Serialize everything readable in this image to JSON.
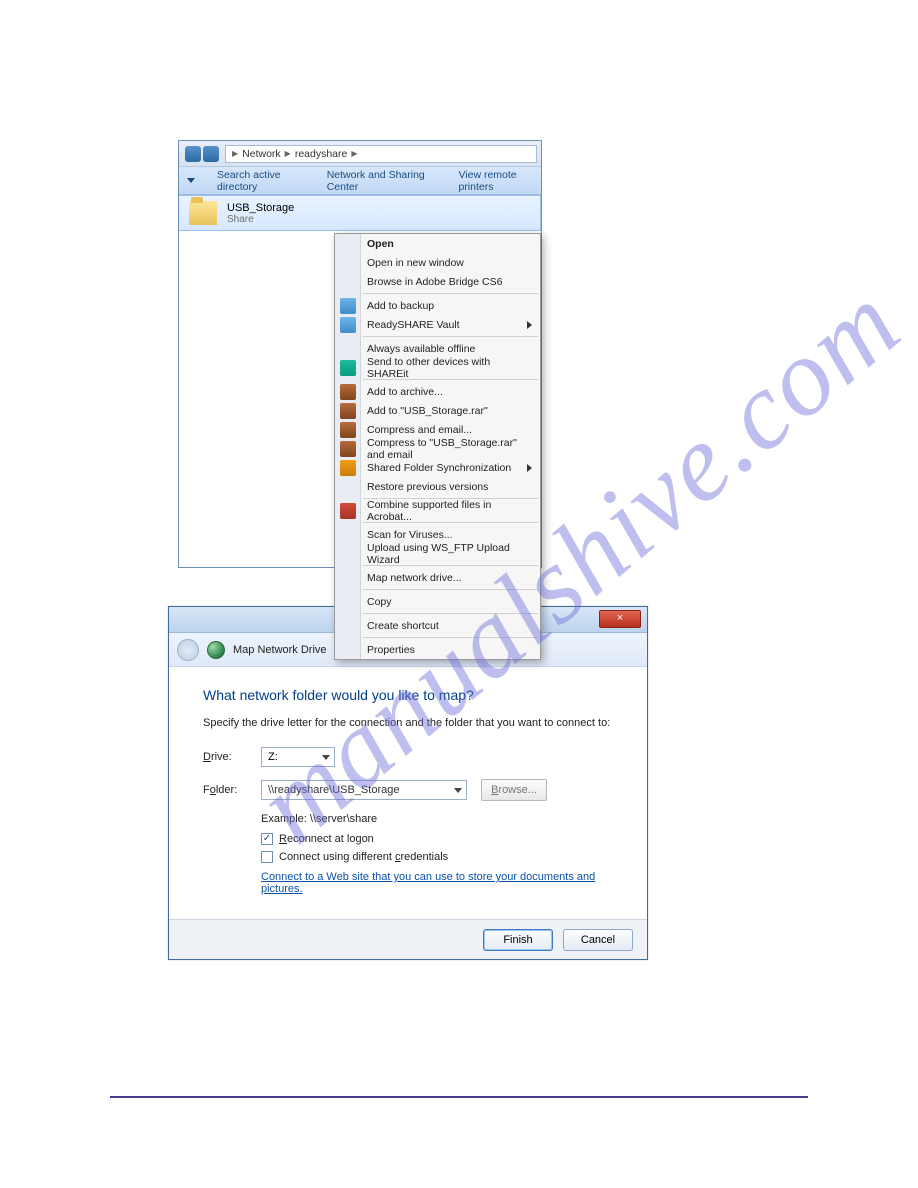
{
  "watermark": "manualshive.com",
  "explorer": {
    "breadcrumb": [
      "Network",
      "readyshare"
    ],
    "toolbar": {
      "search_directory": "Search active directory",
      "network_center": "Network and Sharing Center",
      "remote_printers": "View remote printers"
    },
    "folder": {
      "name": "USB_Storage",
      "subtitle": "Share"
    }
  },
  "context_menu": {
    "open": "Open",
    "open_new": "Open in new window",
    "browse_bridge": "Browse in Adobe Bridge CS6",
    "add_backup": "Add to backup",
    "readyshare_vault": "ReadySHARE Vault",
    "always_offline": "Always available offline",
    "send_shareit": "Send to other devices with SHAREit",
    "add_archive": "Add to archive...",
    "add_to_rar": "Add to \"USB_Storage.rar\"",
    "compress_email": "Compress and email...",
    "compress_to_email": "Compress to \"USB_Storage.rar\" and email",
    "shared_folder_sync": "Shared Folder Synchronization",
    "restore_prev": "Restore previous versions",
    "combine_acrobat": "Combine supported files in Acrobat...",
    "scan_viruses": "Scan for Viruses...",
    "upload_wsftp": "Upload using WS_FTP Upload Wizard",
    "map_drive": "Map network drive...",
    "copy": "Copy",
    "create_shortcut": "Create shortcut",
    "properties": "Properties"
  },
  "map_dialog": {
    "close_x": "×",
    "title": "Map Network Drive",
    "heading": "What network folder would you like to map?",
    "instruction": "Specify the drive letter for the connection and the folder that you want to connect to:",
    "drive_label": "Drive:",
    "drive_value": "Z:",
    "folder_label": "Folder:",
    "folder_value": "\\\\readyshare\\USB_Storage",
    "browse": "Browse...",
    "example": "Example: \\\\server\\share",
    "reconnect": "Reconnect at logon",
    "different_creds": "Connect using different credentials",
    "web_link": "Connect to a Web site that you can use to store your documents and pictures.",
    "finish": "Finish",
    "cancel": "Cancel"
  }
}
